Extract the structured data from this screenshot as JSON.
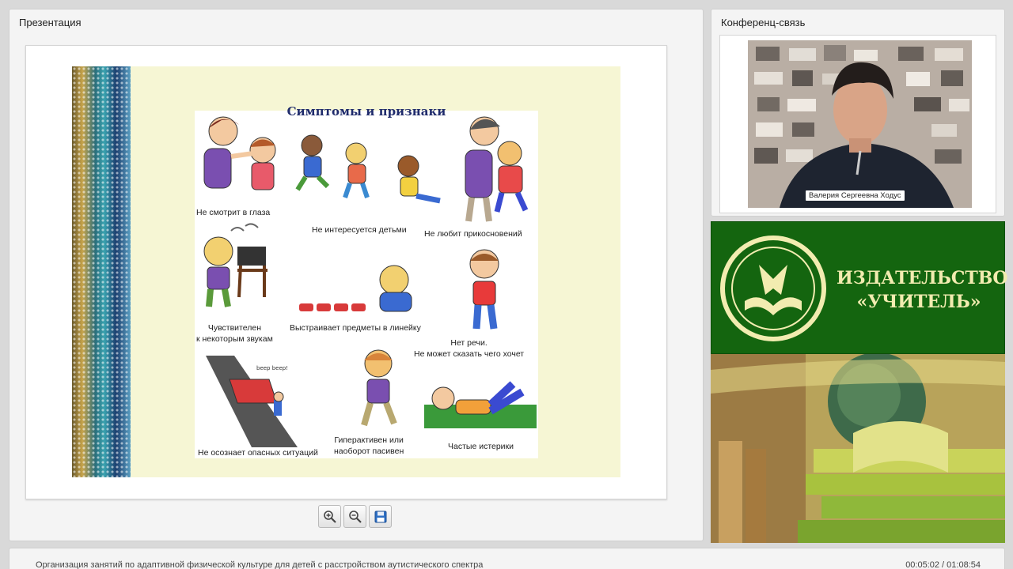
{
  "presentation": {
    "title": "Презентация",
    "slide": {
      "heading": "Симптомы и признаки",
      "captions": [
        "Не смотрит в глаза",
        "Не интересуется детьми",
        "Не любит прикосновений",
        "Чувствителен\nк некоторым звукам",
        "Выстраивает предметы в линейку",
        "Нет речи.\nНе может сказать чего хочет",
        "Не осознает опасных ситуаций",
        "Гиперактивен или\nнаоборот пасивен",
        "Частые истерики"
      ],
      "sound_text": "beep beep!"
    },
    "toolbar": {
      "zoom_in_icon": "zoom-in-icon",
      "zoom_out_icon": "zoom-out-icon",
      "save_icon": "save-icon"
    }
  },
  "conference": {
    "title": "Конференц-связь",
    "presenter_name": "Валерия Сергеевна Ходус"
  },
  "publisher": {
    "name_line1": "ИЗДАТЕЛЬСТВО",
    "name_line2": "«УЧИТЕЛЬ»"
  },
  "footer": {
    "lecture_title": "Организация занятий по адаптивной физической культуре для детей с расстройством аутистического спектра",
    "timer": "00:05:02 / 01:08:54"
  },
  "colors": {
    "accent_green": "#14650f",
    "slide_bg": "#f6f6d4",
    "slide_title": "#1f2b6b"
  }
}
